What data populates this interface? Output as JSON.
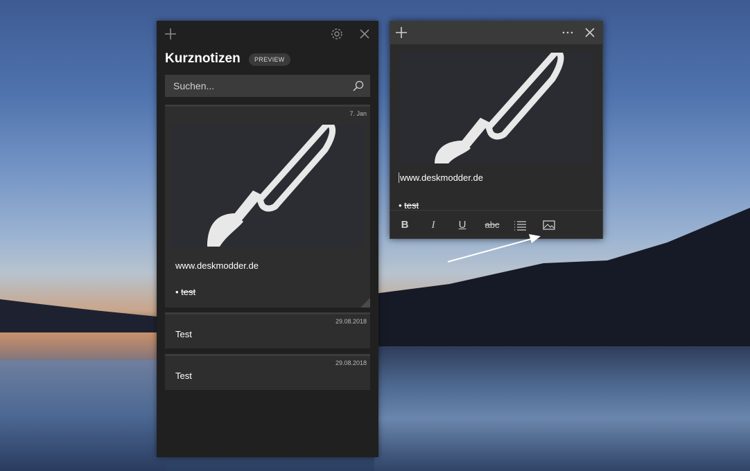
{
  "notes_list": {
    "title": "Kurznotizen",
    "badge": "PREVIEW",
    "search_placeholder": "Suchen...",
    "notes": [
      {
        "date": "7. Jan",
        "text": "www.deskmodder.de",
        "bullet": "test"
      },
      {
        "date": "29.08.2018",
        "text": "Test"
      },
      {
        "date": "29.08.2018",
        "text": "Test"
      }
    ]
  },
  "note_window": {
    "text": "www.deskmodder.de",
    "bullet": "test",
    "toolbar": {
      "bold": "B",
      "italic": "I",
      "underline": "U",
      "strikethrough": "abc"
    }
  },
  "icons": {
    "add": "plus-icon",
    "settings": "gear-icon",
    "close": "close-icon",
    "more": "more-icon",
    "search": "search-icon",
    "list": "list-icon",
    "image": "image-icon",
    "note_image": "paintbrush-icon"
  },
  "colors": {
    "panel_bg": "#202020",
    "card_bg": "#2e2e2e",
    "note_titlebar": "#3a3a3a"
  }
}
